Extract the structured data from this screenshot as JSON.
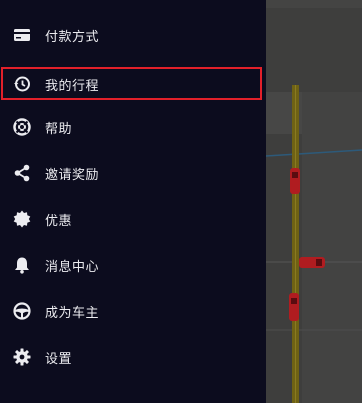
{
  "drawer": {
    "items": [
      {
        "label": "付款方式",
        "icon": "credit-card-icon"
      },
      {
        "label": "我的行程",
        "icon": "history-icon",
        "highlighted": true
      },
      {
        "label": "帮助",
        "icon": "lifebuoy-icon"
      },
      {
        "label": "邀请奖励",
        "icon": "share-icon"
      },
      {
        "label": "优惠",
        "icon": "discount-badge-icon"
      },
      {
        "label": "消息中心",
        "icon": "bell-icon"
      },
      {
        "label": "成为车主",
        "icon": "steering-wheel-icon"
      },
      {
        "label": "设置",
        "icon": "gear-icon"
      }
    ]
  },
  "colors": {
    "drawer_bg": "#0c0c1e",
    "text": "#ececf0",
    "highlight_border": "#e3202a",
    "map_bg": "#3e3e3d",
    "road": "#6f6214",
    "car": "#b01c20"
  }
}
